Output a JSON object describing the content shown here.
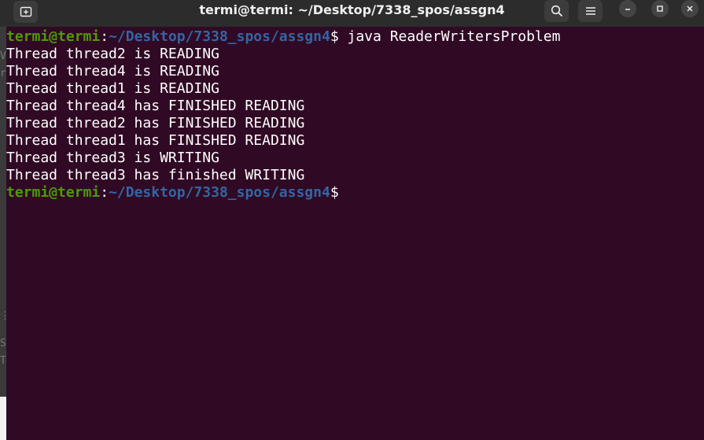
{
  "window": {
    "title": "termi@termi: ~/Desktop/7338_spos/assgn4",
    "buttons": {
      "new_tab": "new-tab-icon",
      "search": "search-icon",
      "menu": "hamburger-menu-icon",
      "minimize": "minimize-icon",
      "maximize": "maximize-icon",
      "close": "close-icon"
    }
  },
  "terminal": {
    "prompt": {
      "user_host": "termi@termi",
      "colon": ":",
      "path": "~/Desktop/7338_spos/assgn4",
      "symbol": "$"
    },
    "command": " java ReaderWritersProblem",
    "output": [
      "Thread thread2 is READING",
      "Thread thread4 is READING",
      "Thread thread1 is READING",
      "Thread thread4 has FINISHED READING",
      "Thread thread2 has FINISHED READING",
      "Thread thread1 has FINISHED READING",
      "Thread thread3 is WRITING",
      "Thread thread3 has finished WRITING"
    ]
  },
  "colors": {
    "terminal_bg": "#300a24",
    "prompt_user": "#4e9a06",
    "prompt_path": "#3465a4",
    "text": "#ffffff",
    "titlebar_bg": "#2c2c2c"
  }
}
